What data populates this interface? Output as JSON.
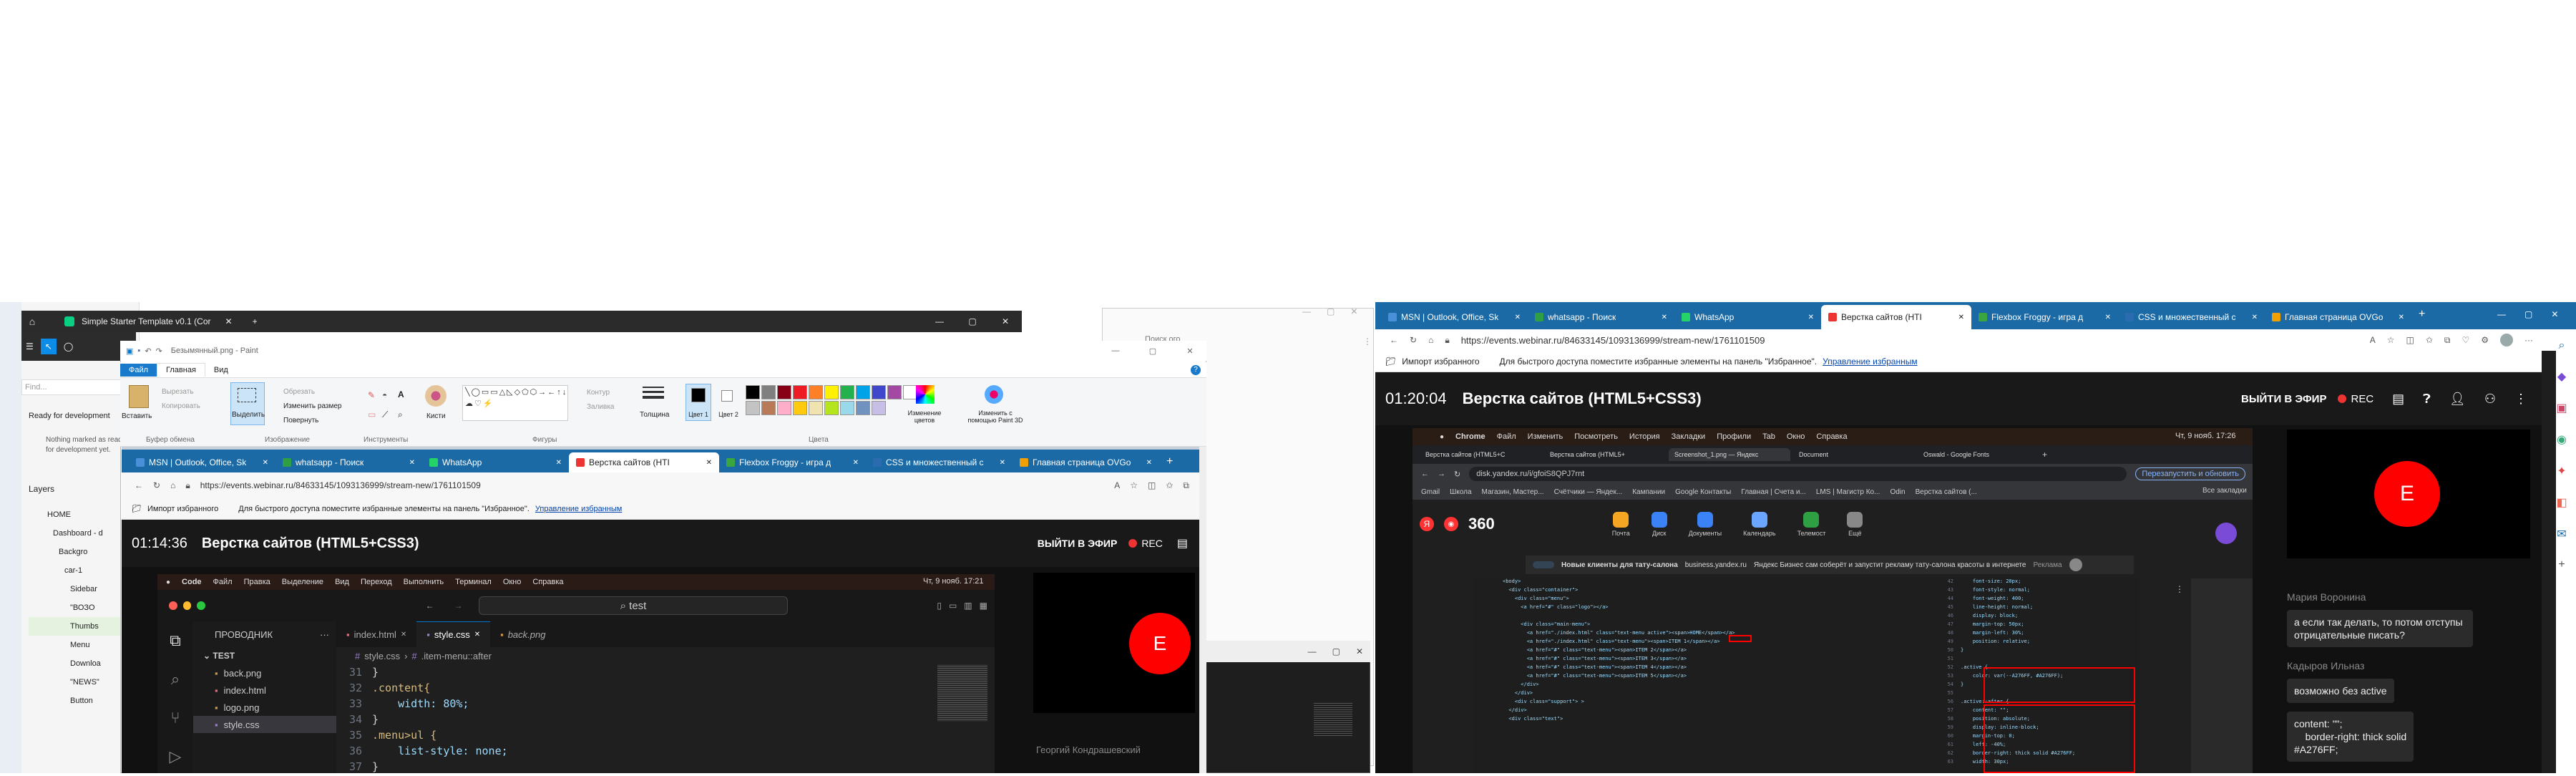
{
  "left_window": {
    "title": "Simple Starter Template v0.1 (Cor",
    "nothing_marked": "Nothing marked as ready for development yet.",
    "ready_label": "Ready for development",
    "layers_title": "Layers",
    "layers": [
      "HOME",
      "Dashboard - d",
      "Backgro",
      "car-1",
      "Sidebar",
      "\"ВОЗО",
      "Thumbs",
      "Menu",
      "Downloa",
      "\"NEWS\"",
      "Button"
    ],
    "find_placeholder": "Find...",
    "search_box": "Поиск ого",
    "menu_top": "⋮"
  },
  "paint": {
    "title": "Безымянный.png - Paint",
    "tabs": [
      "Файл",
      "Главная",
      "Вид"
    ],
    "groups": {
      "clipboard": "Буфер обмена",
      "image": "Изображение",
      "tools": "Инструменты",
      "shapes": "Фигуры",
      "colors": "Цвета"
    },
    "paste": "Вставить",
    "cut": "Вырезать",
    "copy": "Копировать",
    "select": "Выделить",
    "crop": "Обрезать",
    "resize": "Изменить размер",
    "rotate": "Повернуть",
    "brushes": "Кисти",
    "outline": "Контур",
    "fill": "Заливка",
    "thickness": "Толщина",
    "color1": "Цвет 1",
    "color2": "Цвет 2",
    "edit_colors": "Изменение цветов",
    "paint3d": "Изменить с помощью Paint 3D",
    "palette": [
      "#000000",
      "#7f7f7f",
      "#880015",
      "#ed1c24",
      "#ff7f27",
      "#fff200",
      "#22b14c",
      "#00a2e8",
      "#3f48cc",
      "#a349a4",
      "#ffffff",
      "#c3c3c3",
      "#b97a57",
      "#ffaec9",
      "#ffc90e",
      "#efe4b0",
      "#b5e61d",
      "#99d9ea",
      "#7092be",
      "#c8bfe7"
    ]
  },
  "browser_left": {
    "tabs": [
      "MSN | Outlook, Office, Sk",
      "whatsapp - Поиск",
      "WhatsApp",
      "Верстка сайтов (HTI",
      "Flexbox Froggy - игра д",
      "CSS и множественный с",
      "Главная страница OVGo"
    ],
    "url": "https://events.webinar.ru/84633145/1093136999/stream-new/1761101509",
    "fav_import": "Импорт избранного",
    "fav_hint": "Для быстрого доступа поместите избранные элементы на панель \"Избранное\".",
    "fav_link": "Управление избранным",
    "time": "01:14:36",
    "title": "Верстка сайтов (HTML5+CSS3)",
    "live": "ВЫЙТИ В ЭФИР",
    "rec": "REC",
    "avatar": "E",
    "chat_name": "Георгий Кондрашевский"
  },
  "mac_left": {
    "menu": [
      "Code",
      "Файл",
      "Правка",
      "Выделение",
      "Вид",
      "Переход",
      "Выполнить",
      "Терминал",
      "Окно",
      "Справка"
    ],
    "clock": "Чт, 9 нояб. 17:21",
    "search": "test",
    "explorer": "ПРОВОДНИК",
    "folder": "TEST",
    "files": [
      "back.png",
      "index.html",
      "logo.png",
      "style.css"
    ],
    "tabs": [
      "index.html",
      "style.css",
      "back.png"
    ],
    "breadcrumb_file": "style.css",
    "breadcrumb_rule": ".item-menu::after",
    "line_numbers": [
      "31",
      "32",
      "33",
      "34",
      "35",
      "36",
      "37"
    ],
    "code": [
      "}",
      ".content{",
      "    width: 80%;",
      "}",
      ".menu>ul {",
      "    list-style: none;",
      "}"
    ]
  },
  "browser_right": {
    "tabs": [
      "MSN | Outlook, Office, Sk",
      "whatsapp - Поиск",
      "WhatsApp",
      "Верстка сайтов (HTI",
      "Flexbox Froggy - игра д",
      "CSS и множественный с",
      "Главная страница OVGo"
    ],
    "url": "https://events.webinar.ru/84633145/1093136999/stream-new/1761101509",
    "fav_import": "Импорт избранного",
    "fav_hint": "Для быстрого доступа поместите избранные элементы на панель \"Избранное\".",
    "fav_link": "Управление избранным",
    "time": "01:20:04",
    "title": "Верстка сайтов (HTML5+CSS3)",
    "live": "ВЫЙТИ В ЭФИР",
    "rec": "REC",
    "avatar": "E"
  },
  "mac_right": {
    "menu": [
      "Chrome",
      "Файл",
      "Изменить",
      "Посмотреть",
      "История",
      "Закладки",
      "Профили",
      "Tab",
      "Окно",
      "Справка"
    ],
    "clock": "Чт, 9 нояб. 17:26",
    "tabs": [
      "Верстка сайтов (HTML5+C",
      "Верстка сайтов (HTML5+",
      "Screenshot_1.png — Яндекс",
      "Document",
      "Oswald - Google Fonts"
    ],
    "url": "disk.yandex.ru/i/gfoiS8QPJ7rnt",
    "update": "Перезапустить и обновить",
    "bookmarks": [
      "Gmail",
      "Школа",
      "Магазин, Мастер...",
      "Счётчики — Яндек...",
      "Кампании",
      "Google Контакты",
      "Главная | Счета и...",
      "LMS | Магистр Ко...",
      "Odin",
      "Верстка сайтов (..."
    ],
    "all_bookmarks": "Все закладки",
    "y360": "360",
    "apps": [
      "Почта",
      "Диск",
      "Документы",
      "Календарь",
      "Телемост",
      "Ещё"
    ],
    "banner": "Новые клиенты для тату-салона",
    "banner_src": "business.yandex.ru",
    "banner_text": "Яндекс Бизнес сам соберёт и запустит рекламу тату-салона красоты в интернете",
    "banner_ad": "Реклама",
    "html_lines": [
      "<body>",
      "  <div class=\"container\">",
      "    <div class=\"menu\">",
      "      <a href=\"#\" class=\"logo\"></a>",
      "",
      "      <div class=\"main-menu\">",
      "        <a href=\"./index.html\" class=\"text-menu active\"><span>HOME</span></a>",
      "        <a href=\"./index.html\" class=\"text-menu\"><span>ITEM 1</span></a>",
      "        <a href=\"#\" class=\"text-menu\"><span>ITEM 2</span></a>",
      "        <a href=\"#\" class=\"text-menu\"><span>ITEM 3</span></a>",
      "        <a href=\"#\" class=\"text-menu\"><span>ITEM 4</span></a>",
      "        <a href=\"#\" class=\"text-menu\"><span>ITEM 5</span></a>",
      "      </div>",
      "    </div>",
      "    <div class=\"support\"> >",
      "  </div>",
      "  <div class=\"text\">"
    ],
    "css_nums": [
      "42",
      "43",
      "44",
      "45",
      "46",
      "47",
      "48",
      "49",
      "50",
      "51",
      "52",
      "53",
      "54",
      "55",
      "56",
      "57",
      "58",
      "59",
      "60",
      "61",
      "62",
      "63"
    ],
    "css_lines": [
      "    font-size: 20px;",
      "    font-style: normal;",
      "    font-weight: 400;",
      "    line-height: normal;",
      "    display: block;",
      "    margin-top: 50px;",
      "    margin-left: 30%;",
      "    position: relative;",
      "}",
      "",
      ".active {",
      "    color: var(--A276FF, #A276FF);",
      "}",
      "",
      ".active::after {",
      "    content: \"\";",
      "    position: absolute;",
      "    display: inline-block;",
      "    margin-top: 0;",
      "    left: -40%;",
      "    border-right: thick solid #A276FF;",
      "    width: 30px;"
    ]
  },
  "chat": {
    "msgs": [
      {
        "author": "Мария Воронина",
        "text": "а если так делать, то потом отступы отрицательные писать?"
      },
      {
        "author": "Кадыров Ильназ",
        "text": "возможно без active"
      },
      {
        "author": "",
        "text": "content: \"\";\n    border-right: thick solid\n#A276FF;"
      }
    ]
  },
  "right_sidebar_icons": [
    "search-icon",
    "pin-icon",
    "bag-icon",
    "person-icon",
    "tools-icon",
    "office-icon",
    "outlook-icon",
    "plus-icon"
  ]
}
